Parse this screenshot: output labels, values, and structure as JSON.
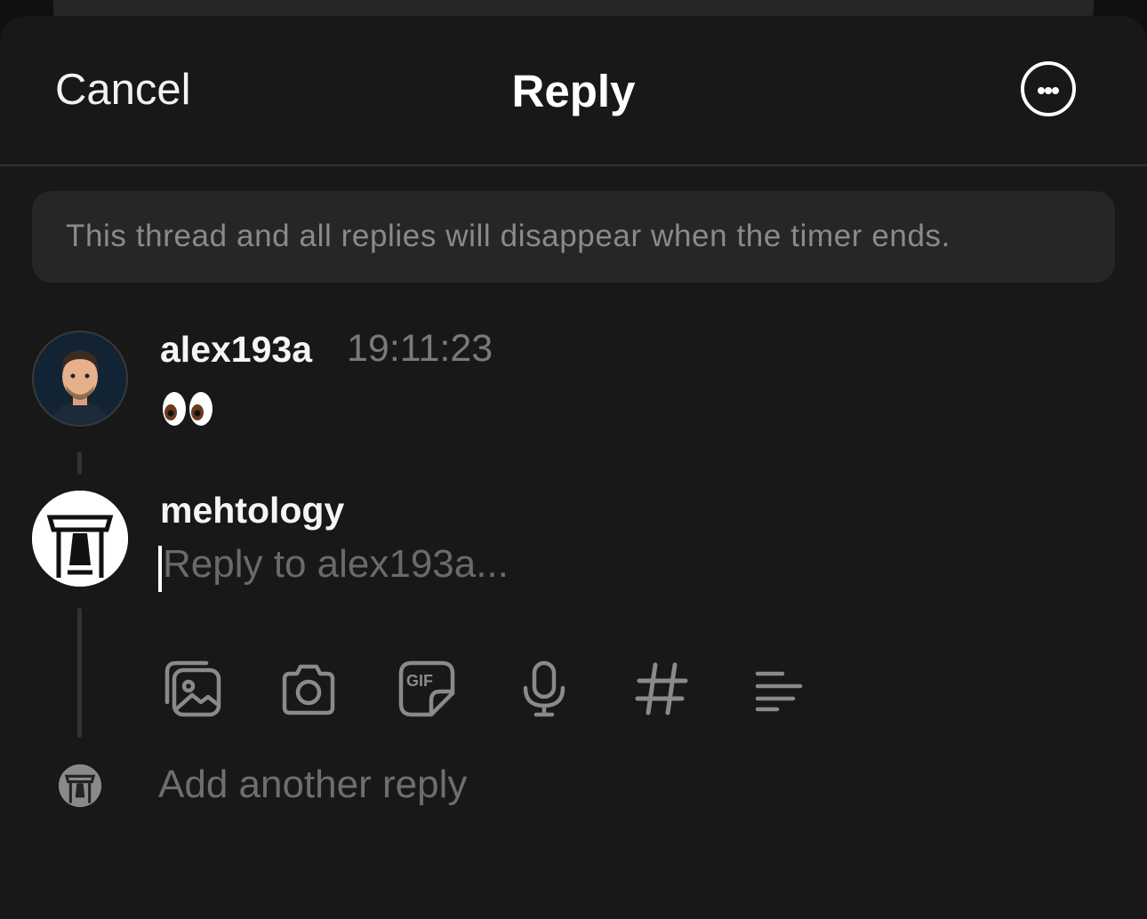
{
  "header": {
    "cancel_label": "Cancel",
    "title": "Reply",
    "more_icon": "more-horizontal-circle-icon"
  },
  "notice": {
    "text": "This thread and all replies will disappear when the timer ends."
  },
  "original_post": {
    "username": "alex193a",
    "timestamp": "19:11:23",
    "content": "eyes-emoji"
  },
  "reply": {
    "username": "mehtology",
    "placeholder": "Reply to alex193a..."
  },
  "toolbar": {
    "items": [
      "photo-library-icon",
      "camera-icon",
      "gif-icon",
      "microphone-icon",
      "hashtag-icon",
      "poll-icon"
    ]
  },
  "add_reply": {
    "label": "Add another reply"
  },
  "colors": {
    "background": "#181818",
    "notice_bg": "#262626",
    "text_primary": "#f5f5f5",
    "text_secondary": "#7a7a7a"
  }
}
